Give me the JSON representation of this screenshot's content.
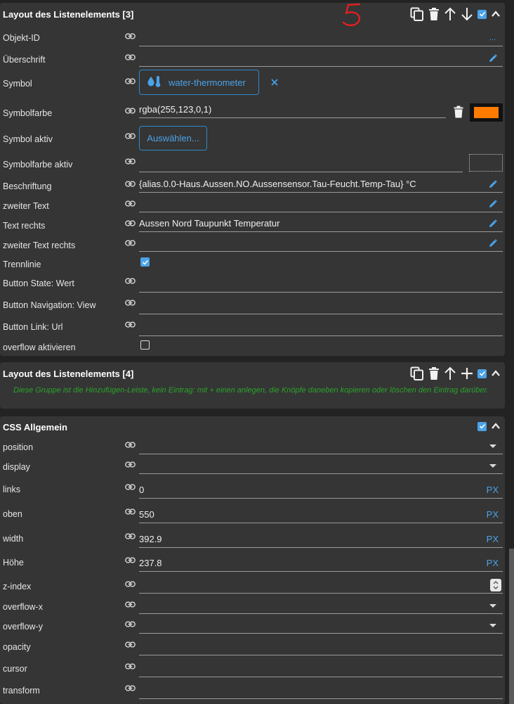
{
  "panel1": {
    "title": "Layout des Listenelements [3]",
    "rows": {
      "objekt_id": {
        "label": "Objekt-ID",
        "value": "",
        "dots": "..."
      },
      "ueberschrift": {
        "label": "Überschrift",
        "value": ""
      },
      "symbol": {
        "label": "Symbol",
        "value": "water-thermometer",
        "icon": "water-thermometer-icon"
      },
      "symbolfarbe": {
        "label": "Symbolfarbe",
        "value": "rgba(255,123,0,1)",
        "swatch_color": "#ff7b00"
      },
      "symbol_aktiv": {
        "label": "Symbol aktiv",
        "button": "Auswählen..."
      },
      "symbolfarbe_aktiv": {
        "label": "Symbolfarbe aktiv",
        "value": ""
      },
      "beschriftung": {
        "label": "Beschriftung",
        "value": "{alias.0.0-Haus.Aussen.NO.Aussensensor.Tau-Feucht.Temp-Tau} °C"
      },
      "zweiter_text": {
        "label": "zweiter Text",
        "value": ""
      },
      "text_rechts": {
        "label": "Text rechts",
        "value": "Aussen Nord Taupunkt Temperatur"
      },
      "zweiter_text_rechts": {
        "label": "zweiter Text rechts",
        "value": ""
      },
      "trennlinie": {
        "label": "Trennlinie",
        "checked": true
      },
      "button_state": {
        "label": "Button State: Wert",
        "value": ""
      },
      "button_navigation": {
        "label": "Button Navigation: View",
        "value": ""
      },
      "button_link": {
        "label": "Button Link: Url",
        "value": ""
      },
      "overflow_aktivieren": {
        "label": "overflow aktivieren",
        "checked": false
      }
    }
  },
  "panel2": {
    "title": "Layout des Listenelements [4]",
    "note": "Diese Gruppe ist die Hinzufügen-Leiste, kein Eintrag: mit + einen anlegen, die Knöpfe daneben kopieren oder löschen den Eintrag darüber."
  },
  "panel3": {
    "title": "CSS Allgemein",
    "rows": {
      "position": {
        "label": "position",
        "value": ""
      },
      "display": {
        "label": "display",
        "value": ""
      },
      "links": {
        "label": "links",
        "value": "0",
        "unit": "PX"
      },
      "oben": {
        "label": "oben",
        "value": "550",
        "unit": "PX"
      },
      "width": {
        "label": "width",
        "value": "392.9",
        "unit": "PX"
      },
      "hoehe": {
        "label": "Höhe",
        "value": "237.8",
        "unit": "PX"
      },
      "z_index": {
        "label": "z-index",
        "value": ""
      },
      "overflow_x": {
        "label": "overflow-x",
        "value": ""
      },
      "overflow_y": {
        "label": "overflow-y",
        "value": ""
      },
      "opacity": {
        "label": "opacity",
        "value": ""
      },
      "cursor": {
        "label": "cursor",
        "value": ""
      },
      "transform": {
        "label": "transform",
        "value": ""
      }
    }
  },
  "colors": {
    "accent": "#4ba3e8",
    "note": "#2aa32a",
    "annotation": "#e02020"
  }
}
